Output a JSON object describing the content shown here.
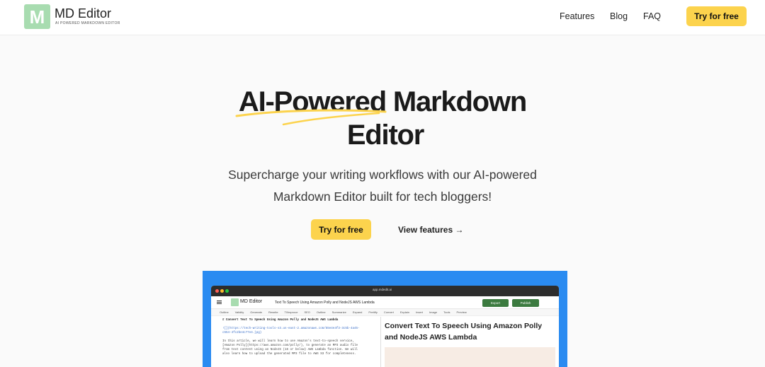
{
  "header": {
    "logo_letter": "M",
    "brand": "MD Editor",
    "tagline": "AI POWERED MARKDOWN EDITOR",
    "nav": [
      "Features",
      "Blog",
      "FAQ"
    ],
    "cta": "Try for free"
  },
  "hero": {
    "title_line1": "AI-Powered Markdown",
    "title_line2": "Editor",
    "subtitle_line1": "Supercharge your writing workflows with our AI-powered",
    "subtitle_line2": "Markdown Editor built for tech bloggers!",
    "primary_cta": "Try for free",
    "secondary_cta": "View features →"
  },
  "colors": {
    "accent": "#fcd34d",
    "logo": "#a8dcb0",
    "screenshot_bg": "#2a8bf1"
  },
  "screenshot": {
    "url": "app.mdedit.ai",
    "app_brand": "MD Editor",
    "doc_title": "Text To Speech Using Amazon Polly and NodeJS AWS Lambda",
    "export": "Export",
    "publish": "Publish",
    "toolbar": [
      "Outline",
      "Validity",
      "Generate",
      "Rewrite",
      "Tl/Improve",
      "SEO",
      "Outline",
      "Summarize",
      "Expand",
      "Prettify",
      "Convert",
      "Explain",
      "Insert",
      "Image",
      "Tools",
      "Preview"
    ],
    "code_lines": [
      "# Convert Text To Speech Using Amazon Polly and NodeJS AWS Lambda",
      "",
      "![](https://tech-writing-tools-s3.us-east-2.amazonaws.com/55e4e4f3-3c5b-4a45-",
      "c554-4fc2be4c77e4.jpg)",
      "",
      "In this article, we will learn how to use Amazon's text-to-speech service,",
      "[Amazon Polly](https://aws.amazon.com/polly/), to generate an MP3 audio file",
      "from text content using an NodeJS (16 or below) AWS Lambda function. We will",
      "also learn how to upload the generated MP3 file to AWS S3 for completeness."
    ],
    "preview_title": "Convert Text To Speech Using Amazon Polly and NodeJS AWS Lambda"
  }
}
